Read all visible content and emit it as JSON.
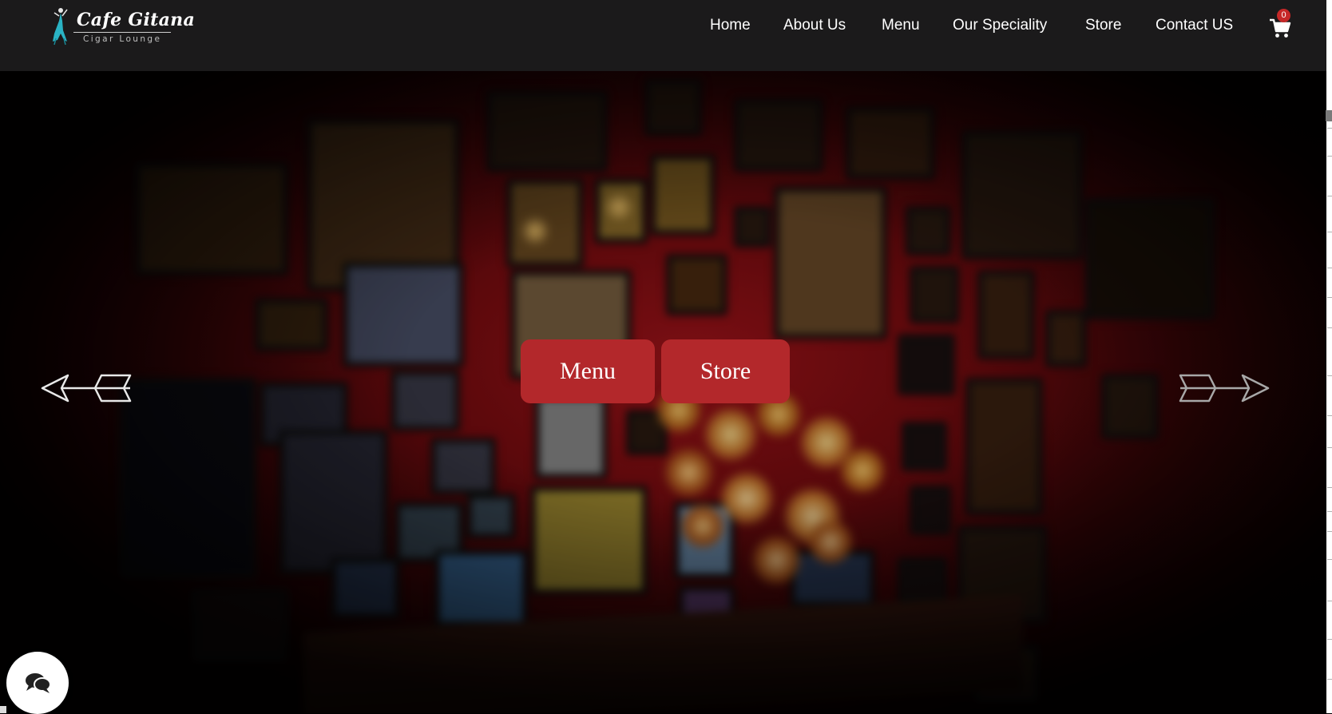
{
  "brand": {
    "title": "Cafe Gitana",
    "subtitle": "Cigar Lounge"
  },
  "nav": {
    "items": [
      {
        "label": "Home"
      },
      {
        "label": "About Us"
      },
      {
        "label": "Menu"
      },
      {
        "label": "Our Speciality"
      },
      {
        "label": "Store"
      },
      {
        "label": "Contact US"
      }
    ],
    "cart_icon": "cart-icon",
    "cart_count": "0"
  },
  "hero": {
    "buttons": {
      "menu_label": "Menu",
      "store_label": "Store"
    },
    "prev_icon": "arrow-left-icon",
    "next_icon": "arrow-right-icon"
  },
  "chat": {
    "icon": "chat-bubbles-icon"
  },
  "colors": {
    "header_bg": "#1b1a1b",
    "button_bg": "#b3282b",
    "badge_bg": "#c62828"
  }
}
